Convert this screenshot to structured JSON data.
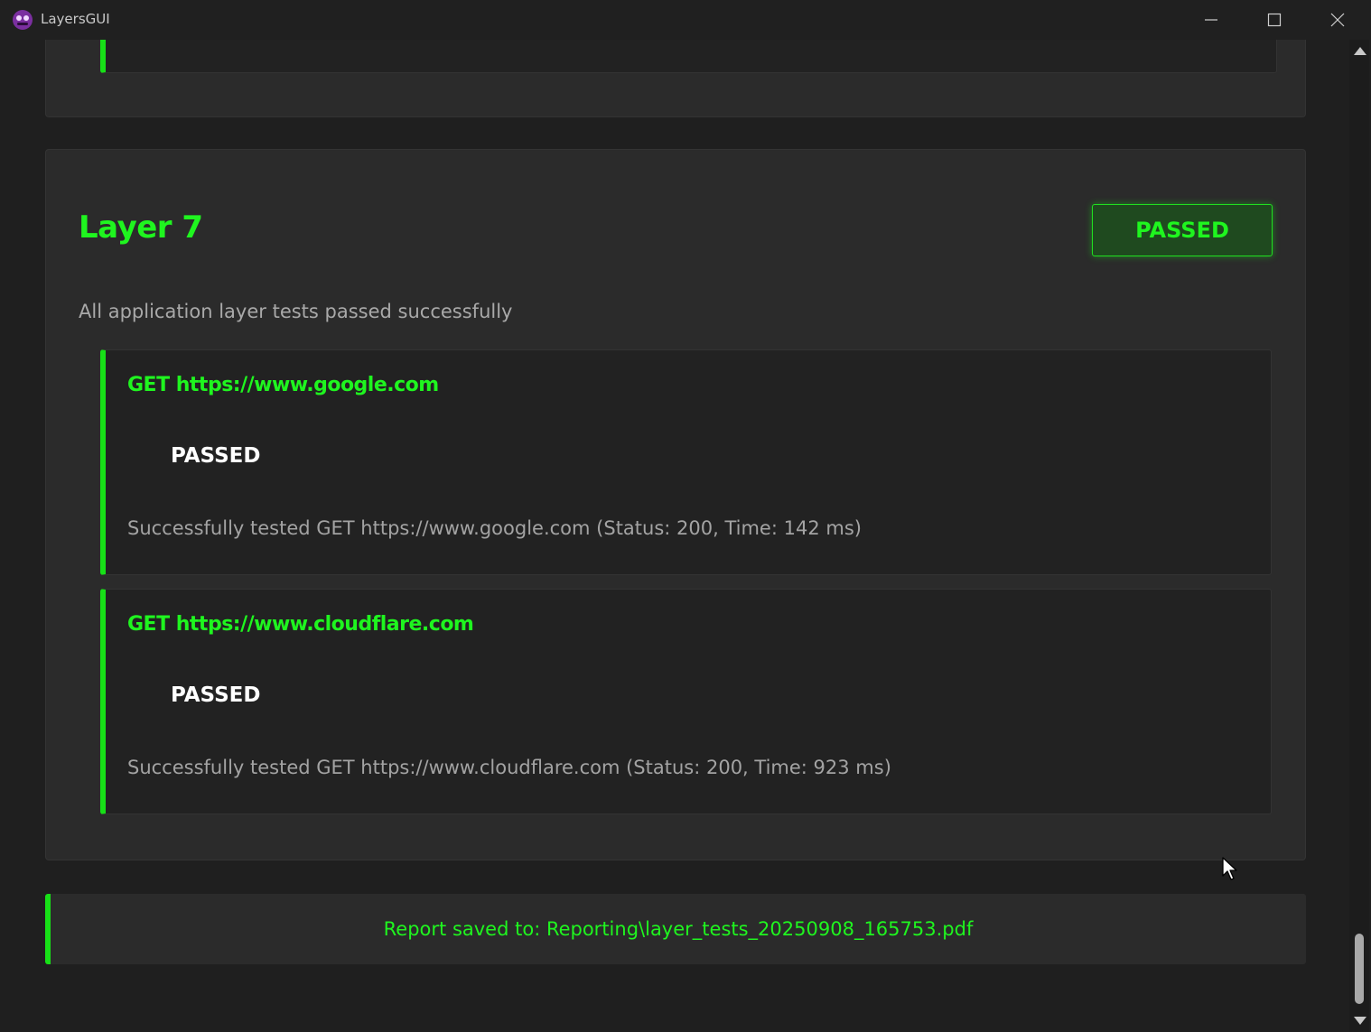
{
  "window": {
    "title": "LayersGUI",
    "icon": "app-logo-icon",
    "controls": [
      "minimize-icon",
      "maximize-icon",
      "close-icon"
    ]
  },
  "layer": {
    "title": "Layer 7",
    "status": "PASSED",
    "description": "All application layer tests passed successfully",
    "accent_color": "#1ff51f",
    "tests": [
      {
        "name": "GET https://www.google.com",
        "status": "PASSED",
        "detail": "Successfully tested GET https://www.google.com (Status: 200, Time: 142 ms)"
      },
      {
        "name": "GET https://www.cloudflare.com",
        "status": "PASSED",
        "detail": "Successfully tested GET https://www.cloudflare.com (Status: 200, Time: 923 ms)"
      }
    ]
  },
  "report": {
    "message": "Report saved to: Reporting\\layer_tests_20250908_165753.pdf"
  }
}
